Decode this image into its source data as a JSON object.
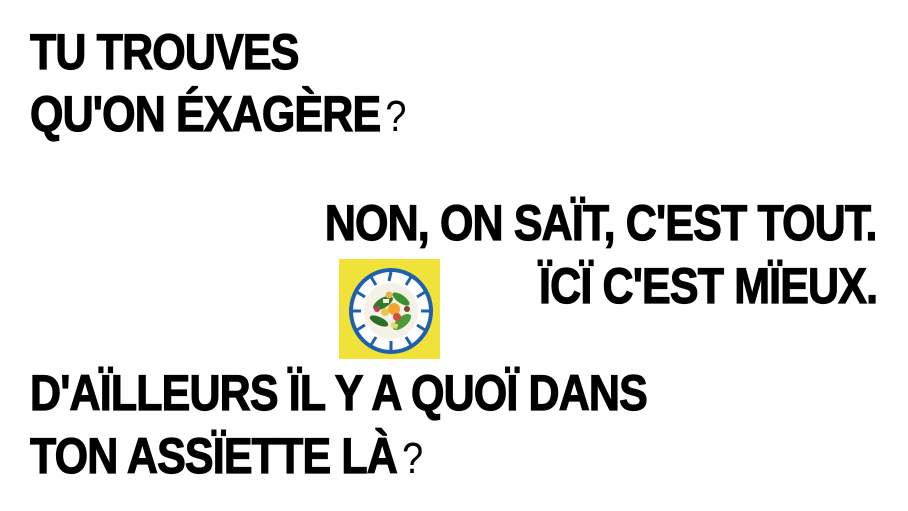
{
  "lines": {
    "l1": "TU TROUVES",
    "l2": "QU'ON ÉXAGÈRE",
    "l3": "NON, ON SAÏT, C'EST TOUT.",
    "l4": "ÏCÏ C'EST MÏEUX.",
    "l5": "D'AÏLLEURS ÏL Y A QUOÏ DANS",
    "l6": "TON ASSÏETTE LÀ"
  },
  "punct": {
    "question_1": "?",
    "question_2": "?"
  },
  "image": {
    "icon": "salad-plate",
    "background": "#f1e23a"
  },
  "colors": {
    "text": "#000000",
    "background": "#ffffff",
    "tile": "#f1e23a",
    "plate_rim": "#1f5fb0"
  }
}
